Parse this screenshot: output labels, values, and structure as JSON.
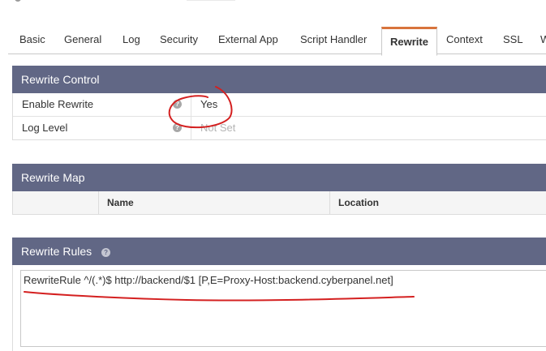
{
  "tabs": [
    {
      "label": "Basic"
    },
    {
      "label": "General"
    },
    {
      "label": "Log"
    },
    {
      "label": "Security"
    },
    {
      "label": "External App"
    },
    {
      "label": "Script Handler"
    },
    {
      "label": "Rewrite",
      "active": true
    },
    {
      "label": "Context"
    },
    {
      "label": "SSL"
    },
    {
      "label": "W"
    }
  ],
  "rewrite_control": {
    "title": "Rewrite Control",
    "rows": [
      {
        "label": "Enable Rewrite",
        "value": "Yes"
      },
      {
        "label": "Log Level",
        "value": "Not Set"
      }
    ]
  },
  "rewrite_map": {
    "title": "Rewrite Map",
    "columns": [
      "Name",
      "Location"
    ]
  },
  "rewrite_rules": {
    "title": "Rewrite Rules",
    "content": "RewriteRule ^/(.*)$ http://backend/$1 [P,E=Proxy-Host:backend.cyberpanel.net]"
  },
  "help_glyph": "?",
  "colors": {
    "panel_header": "#616785",
    "active_tab_accent": "#d8743c",
    "annotation": "#d42020"
  }
}
